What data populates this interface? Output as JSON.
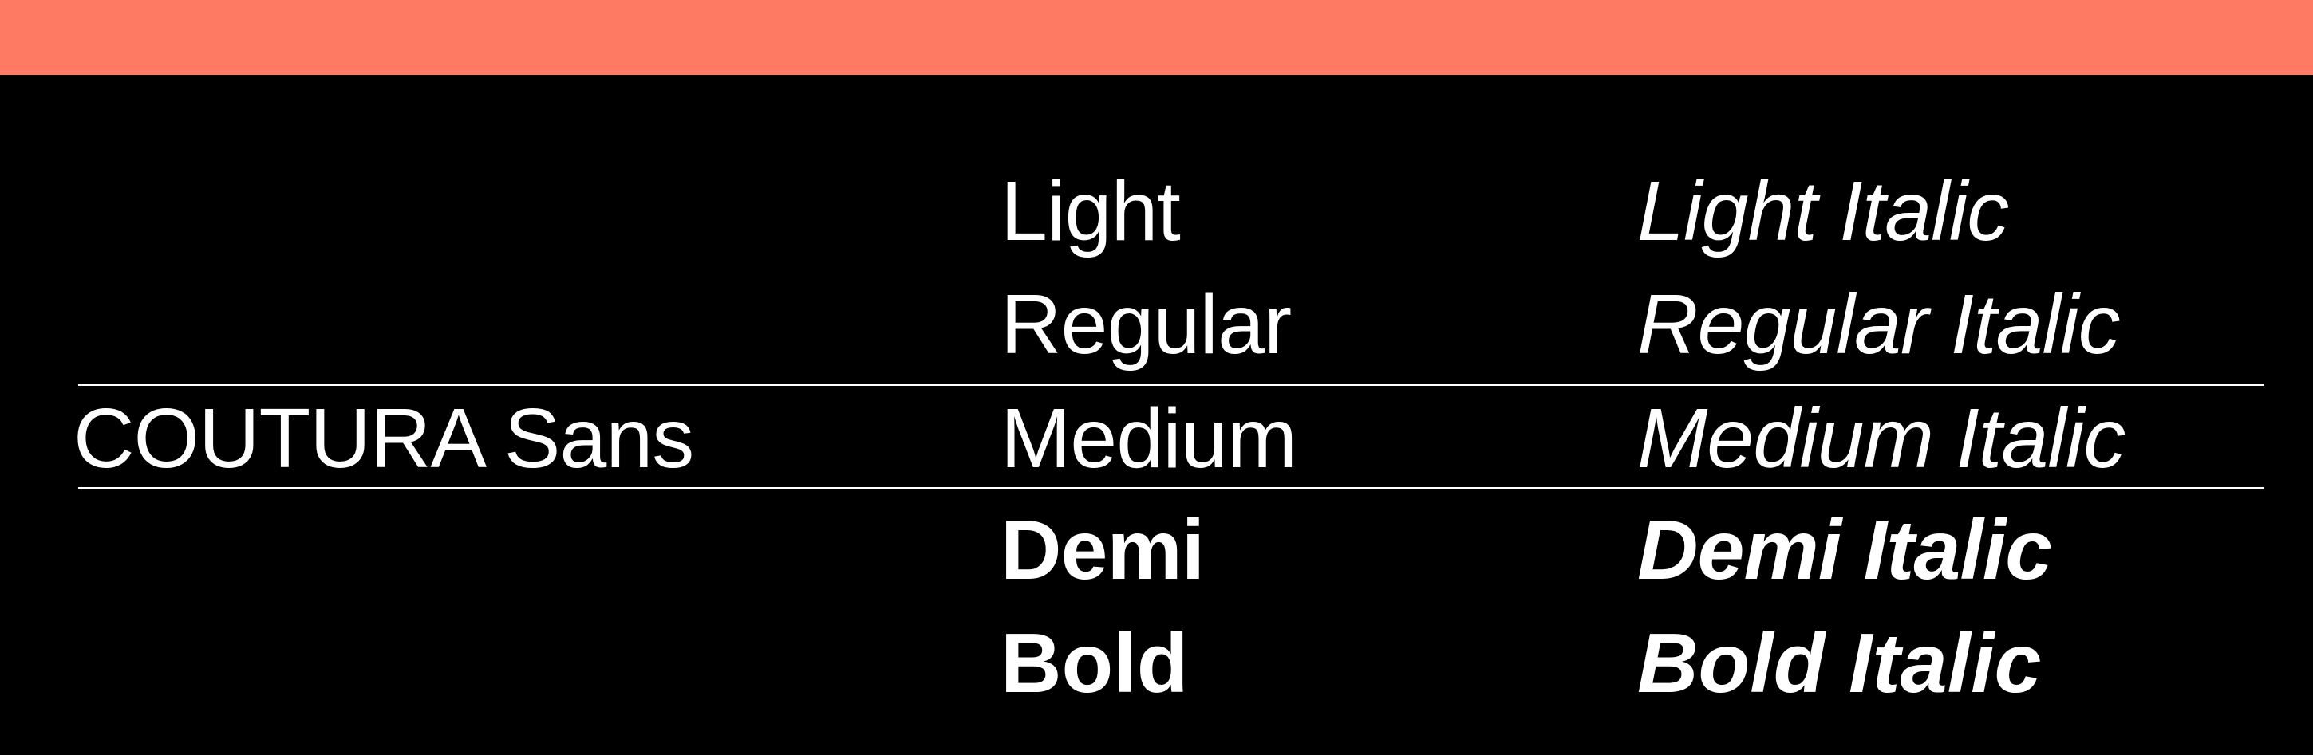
{
  "header": {
    "bar_color": "#ff7a63"
  },
  "family": {
    "name": "COUTURA Sans"
  },
  "weights": [
    {
      "roman": "Light",
      "italic": "Light Italic"
    },
    {
      "roman": "Regular",
      "italic": "Regular Italic"
    },
    {
      "roman": "Medium",
      "italic": "Medium Italic"
    },
    {
      "roman": "Demi",
      "italic": "Demi Italic"
    },
    {
      "roman": "Bold",
      "italic": "Bold Italic"
    }
  ],
  "colors": {
    "background": "#000000",
    "text": "#ffffff",
    "accent": "#ff7a63"
  }
}
